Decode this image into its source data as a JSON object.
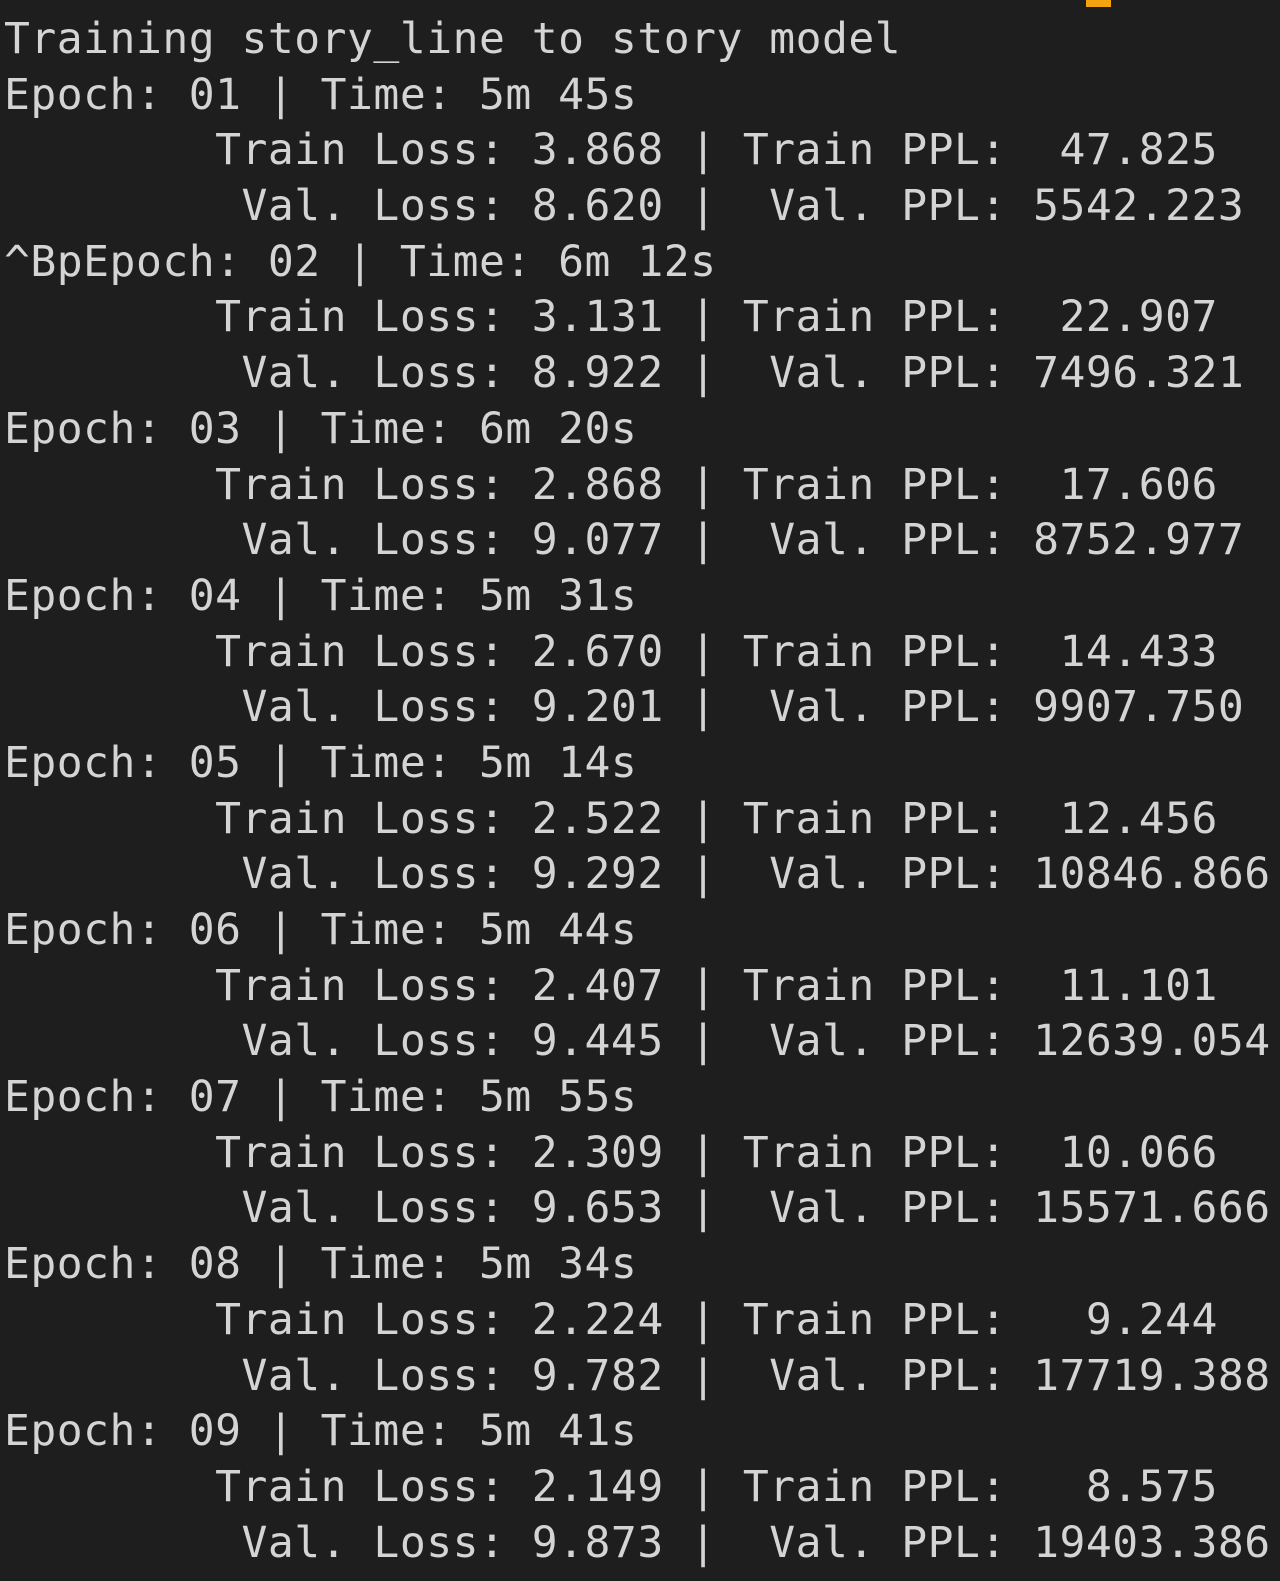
{
  "terminal": {
    "cursor_color": "#f2a30f",
    "background": "#1e1e1e",
    "foreground": "#d4d4d4",
    "lines": [
      "Training story_line to story model",
      "Epoch: 01 | Time: 5m 45s",
      "        Train Loss: 3.868 | Train PPL:  47.825",
      "         Val. Loss: 8.620 |  Val. PPL: 5542.223",
      "^BpEpoch: 02 | Time: 6m 12s",
      "        Train Loss: 3.131 | Train PPL:  22.907",
      "         Val. Loss: 8.922 |  Val. PPL: 7496.321",
      "Epoch: 03 | Time: 6m 20s",
      "        Train Loss: 2.868 | Train PPL:  17.606",
      "         Val. Loss: 9.077 |  Val. PPL: 8752.977",
      "Epoch: 04 | Time: 5m 31s",
      "        Train Loss: 2.670 | Train PPL:  14.433",
      "         Val. Loss: 9.201 |  Val. PPL: 9907.750",
      "Epoch: 05 | Time: 5m 14s",
      "        Train Loss: 2.522 | Train PPL:  12.456",
      "         Val. Loss: 9.292 |  Val. PPL: 10846.866",
      "Epoch: 06 | Time: 5m 44s",
      "        Train Loss: 2.407 | Train PPL:  11.101",
      "         Val. Loss: 9.445 |  Val. PPL: 12639.054",
      "Epoch: 07 | Time: 5m 55s",
      "        Train Loss: 2.309 | Train PPL:  10.066",
      "         Val. Loss: 9.653 |  Val. PPL: 15571.666",
      "Epoch: 08 | Time: 5m 34s",
      "        Train Loss: 2.224 | Train PPL:   9.244",
      "         Val. Loss: 9.782 |  Val. PPL: 17719.388",
      "Epoch: 09 | Time: 5m 41s",
      "        Train Loss: 2.149 | Train PPL:   8.575",
      "         Val. Loss: 9.873 |  Val. PPL: 19403.386"
    ]
  }
}
